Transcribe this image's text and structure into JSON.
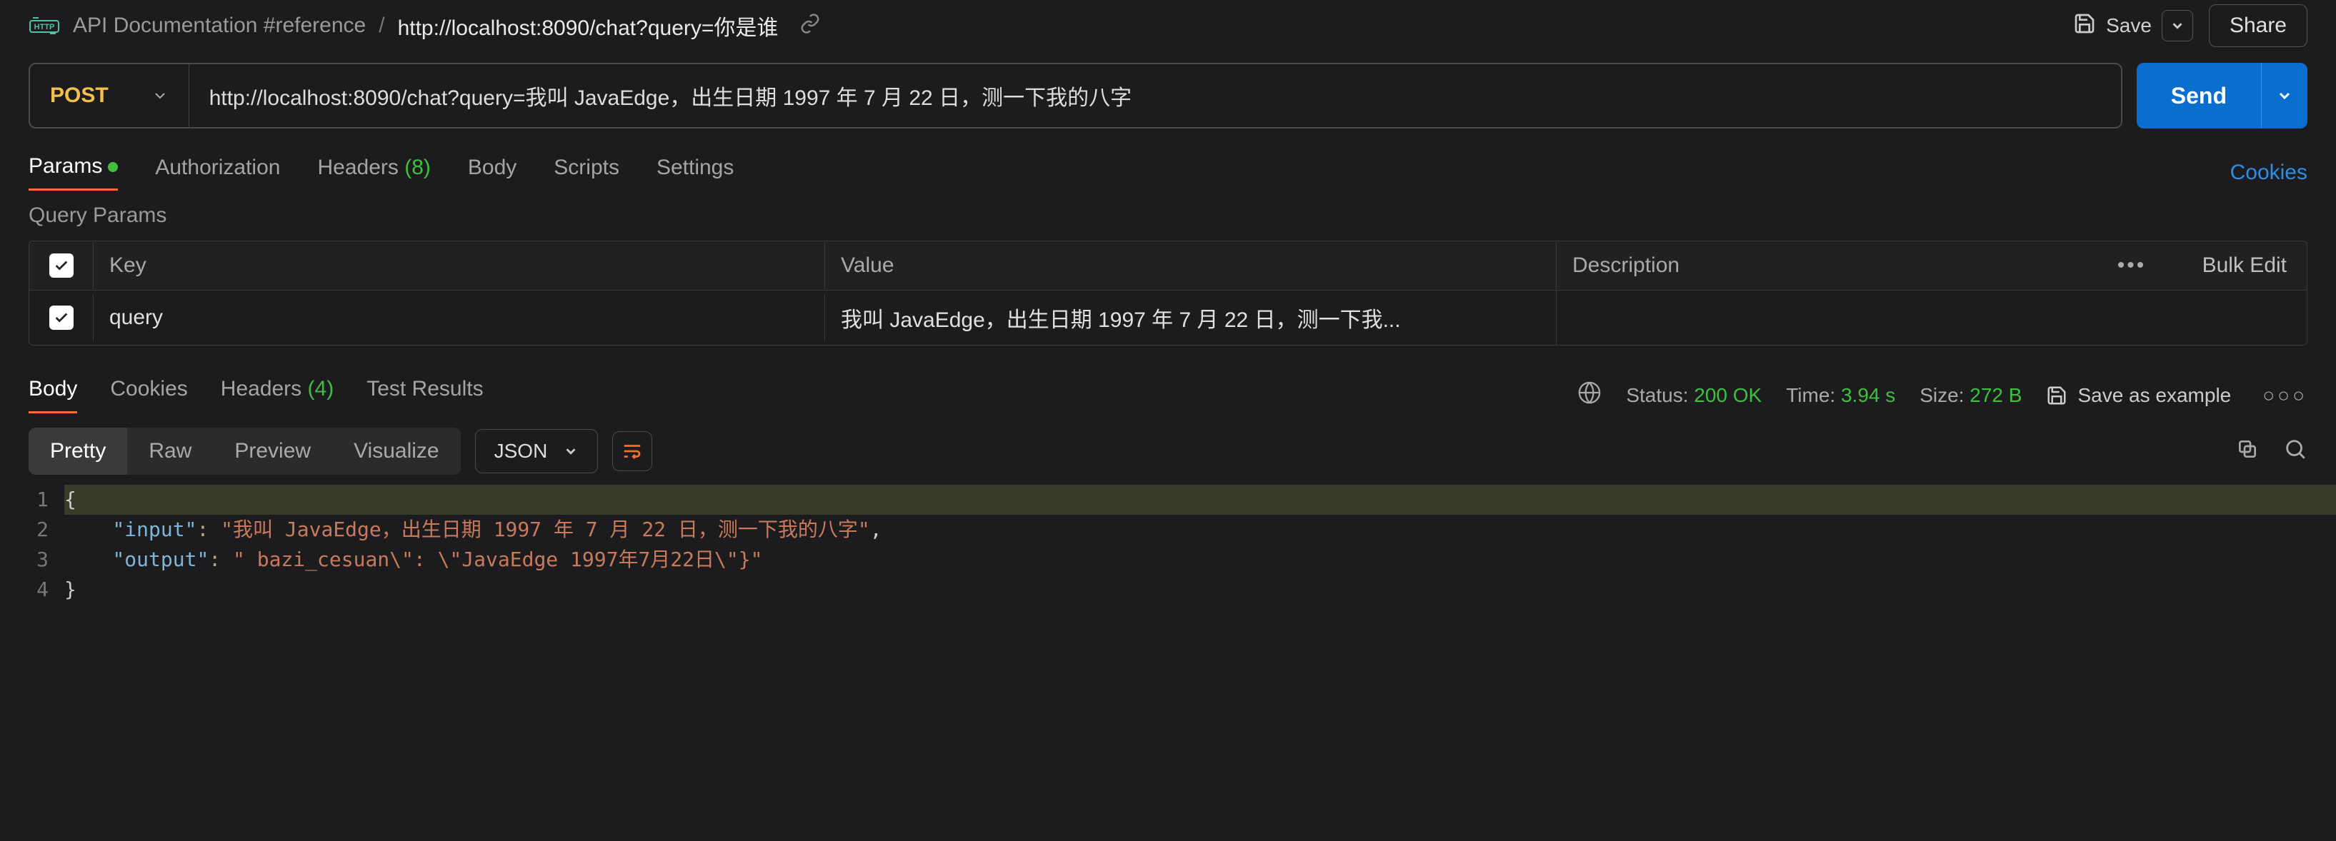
{
  "breadcrumb": {
    "reference": "API Documentation #reference",
    "endpoint": "http://localhost:8090/chat?query=你是谁"
  },
  "header": {
    "save": "Save",
    "share": "Share"
  },
  "request": {
    "method": "POST",
    "url": "http://localhost:8090/chat?query=我叫 JavaEdge，出生日期 1997 年 7 月 22 日，测一下我的八字",
    "send": "Send"
  },
  "reqTabs": {
    "params": "Params",
    "authorization": "Authorization",
    "headers": "Headers",
    "headersCount": "(8)",
    "body": "Body",
    "scripts": "Scripts",
    "settings": "Settings",
    "cookies": "Cookies"
  },
  "paramsSection": {
    "title": "Query Params",
    "colKey": "Key",
    "colValue": "Value",
    "colDesc": "Description",
    "bulkEdit": "Bulk Edit",
    "rows": [
      {
        "checked": true,
        "key": "query",
        "value": "我叫 JavaEdge，出生日期 1997 年 7 月 22 日，测一下我...",
        "description": ""
      }
    ]
  },
  "respTabs": {
    "body": "Body",
    "cookies": "Cookies",
    "headers": "Headers",
    "headersCount": "(4)",
    "testResults": "Test Results"
  },
  "respMeta": {
    "statusLabel": "Status:",
    "statusValue": "200 OK",
    "timeLabel": "Time:",
    "timeValue": "3.94 s",
    "sizeLabel": "Size:",
    "sizeValue": "272 B",
    "saveExample": "Save as example"
  },
  "respToolbar": {
    "pretty": "Pretty",
    "raw": "Raw",
    "preview": "Preview",
    "visualize": "Visualize",
    "format": "JSON"
  },
  "responseBody": {
    "line1": "{",
    "line2_key": "\"input\"",
    "line2_val": "\"我叫 JavaEdge，出生日期 1997 年 7 月 22 日，测一下我的八字\"",
    "line3_key": "\"output\"",
    "line3_val": "\" bazi_cesuan\\\": \\\"JavaEdge 1997年7月22日\\\"}\"",
    "line4": "}"
  }
}
